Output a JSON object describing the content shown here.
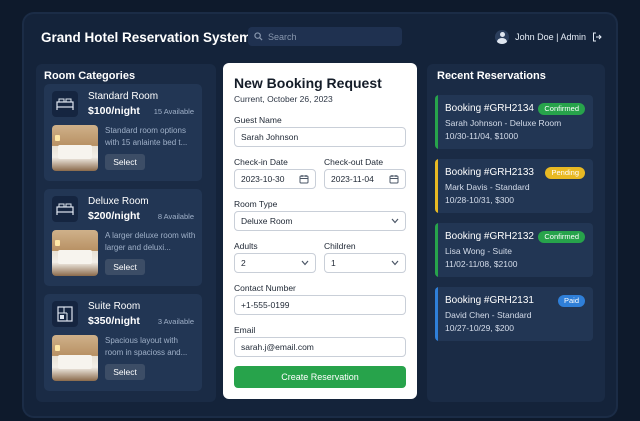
{
  "header": {
    "title": "Grand Hotel Reservation System",
    "search_placeholder": "Search",
    "user_label": "John Doe | Admin"
  },
  "room_categories": {
    "title": "Room Categories",
    "select_label": "Select",
    "rooms": [
      {
        "name": "Standard Room",
        "price": "$100/night",
        "availability": "15 Available",
        "description": "Standard room options with 15 anlainte bed t..."
      },
      {
        "name": "Deluxe Room",
        "price": "$200/night",
        "availability": "8 Available",
        "description": "A larger deluxe room with larger and deluxi..."
      },
      {
        "name": "Suite Room",
        "price": "$350/night",
        "availability": "3 Available",
        "description": "Spacious layout with room in spacioss and..."
      }
    ]
  },
  "booking_form": {
    "title": "New Booking Request",
    "current_date": "Current, October 26, 2023",
    "guest_name_label": "Guest Name",
    "guest_name_value": "Sarah Johnson",
    "checkin_label": "Check-in Date",
    "checkin_value": "2023-10-30",
    "checkout_label": "Check-out Date",
    "checkout_value": "2023-11-04",
    "room_type_label": "Room Type",
    "room_type_value": "Deluxe Room",
    "adults_label": "Adults",
    "adults_value": "2",
    "children_label": "Children",
    "children_value": "1",
    "contact_label": "Contact Number",
    "contact_value": "+1-555-0199",
    "email_label": "Email",
    "email_value": "sarah.j@email.com",
    "submit_label": "Create Reservation"
  },
  "recent_reservations": {
    "title": "Recent Reservations",
    "items": [
      {
        "id": "Booking #GRH2134",
        "status": "Confirmed",
        "guest": "Sarah Johnson - Deluxe Room",
        "details": "10/30-11/04, $1000",
        "color": "#27a34b",
        "bar": "#27a34b"
      },
      {
        "id": "Booking #GRH2133",
        "status": "Pending",
        "guest": "Mark Davis - Standard",
        "details": "10/28-10/31, $300",
        "color": "#e8b923",
        "bar": "#e8b923"
      },
      {
        "id": "Booking #GRH2132",
        "status": "Confirmed",
        "guest": "Lisa Wong - Suite",
        "details": "11/02-11/08, $2100",
        "color": "#27a34b",
        "bar": "#27a34b"
      },
      {
        "id": "Booking #GRH2131",
        "status": "Paid",
        "guest": "David Chen - Standard",
        "details": "10/27-10/29, $200",
        "color": "#2f7fd8",
        "bar": "#2f7fd8"
      }
    ]
  }
}
